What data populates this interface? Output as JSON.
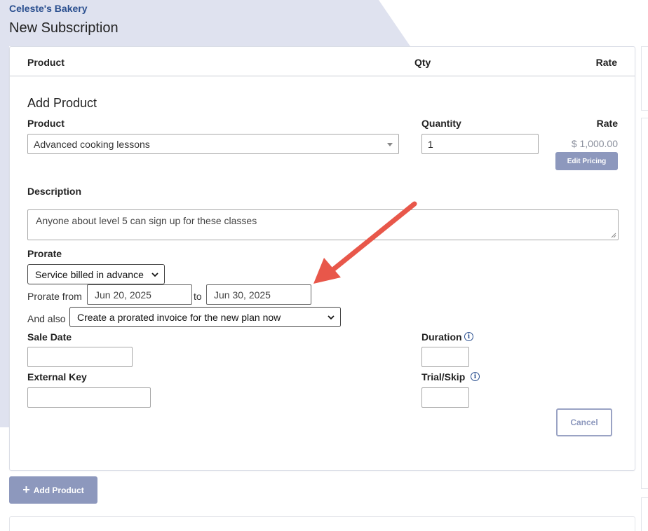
{
  "company": "Celeste's Bakery",
  "page_title": "New Subscription",
  "table_header": {
    "product": "Product",
    "qty": "Qty",
    "rate": "Rate"
  },
  "add_product_section": {
    "title": "Add Product",
    "product_label": "Product",
    "product_value": "Advanced cooking lessons",
    "quantity_label": "Quantity",
    "quantity_value": "1",
    "rate_label": "Rate",
    "rate_value": "$ 1,000.00",
    "edit_pricing_label": "Edit Pricing",
    "description_label": "Description",
    "description_value": "Anyone about level 5 can sign up for these classes",
    "prorate_label": "Prorate",
    "prorate_option": "Service billed in advance",
    "prorate_from_label": "Prorate from",
    "prorate_from_value": "Jun 20, 2025",
    "to_label": "to",
    "prorate_to_value": "Jun 30, 2025",
    "and_also_label": "And also",
    "and_also_option": "Create a prorated invoice for the new plan now",
    "sale_date_label": "Sale Date",
    "sale_date_value": "",
    "external_key_label": "External Key",
    "external_key_value": "",
    "duration_label": "Duration",
    "duration_value": "",
    "trial_skip_label": "Trial/Skip",
    "trial_skip_value": "",
    "cancel_label": "Cancel"
  },
  "add_product_button_label": "Add Product",
  "colors": {
    "brand_blue": "#2a4f8f",
    "button_bg": "#8d98bd",
    "background_shape": "#dfe2ef",
    "annotation_arrow": "#e8574a"
  },
  "icons": {
    "info": "info-icon",
    "plus": "plus-icon",
    "dropdown": "chevron-down-icon",
    "arrow": "annotation-arrow"
  }
}
